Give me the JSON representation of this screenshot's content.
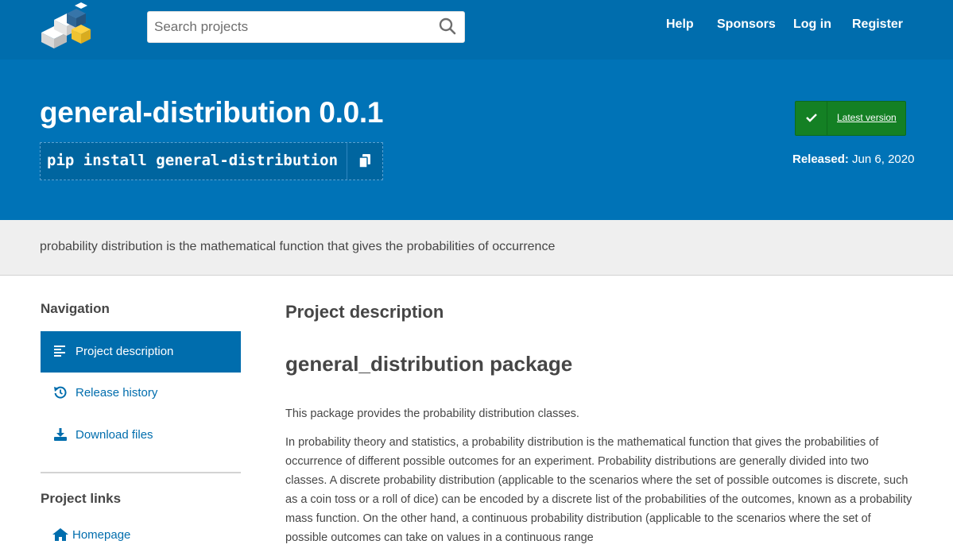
{
  "header": {
    "logo_name": "pypi-logo",
    "search": {
      "placeholder": "Search projects",
      "value": ""
    },
    "nav": [
      {
        "label": "Help"
      },
      {
        "label": "Sponsors"
      },
      {
        "label": "Log in"
      },
      {
        "label": "Register"
      }
    ]
  },
  "package": {
    "title": "general-distribution 0.0.1",
    "pip_command": "pip install general-distribution",
    "latest_label": "Latest version",
    "released_prefix": "Released:",
    "released_date": "Jun 6, 2020",
    "summary": "probability distribution is the mathematical function that gives the probabilities of occurrence"
  },
  "sidebar": {
    "navigation_heading": "Navigation",
    "items": [
      {
        "label": "Project description",
        "icon": "align-left-icon",
        "active": true
      },
      {
        "label": "Release history",
        "icon": "history-icon",
        "active": false
      },
      {
        "label": "Download files",
        "icon": "download-icon",
        "active": false
      }
    ],
    "links_heading": "Project links",
    "links": [
      {
        "label": "Homepage",
        "icon": "home-icon"
      }
    ]
  },
  "main": {
    "section_title": "Project description",
    "readme_title": "general_distribution package",
    "paragraphs": [
      "This package provides the probability distribution classes.",
      "In probability theory and statistics, a probability distribution is the mathematical function that gives the probabilities of occurrence of different possible outcomes for an experiment. Probability distributions are generally divided into two classes. A discrete probability distribution (applicable to the scenarios where the set of possible outcomes is discrete, such as a coin toss or a roll of dice) can be encoded by a discrete list of the probabilities of the outcomes, known as a probability mass function. On the other hand, a continuous probability distribution (applicable to the scenarios where the set of possible outcomes can take on values in a continuous range"
    ]
  },
  "colors": {
    "header_bg": "#006dad",
    "banner_bg": "#0073b7",
    "latest_green": "#148024",
    "link_blue": "#006dad",
    "summary_bg": "#efefef"
  }
}
